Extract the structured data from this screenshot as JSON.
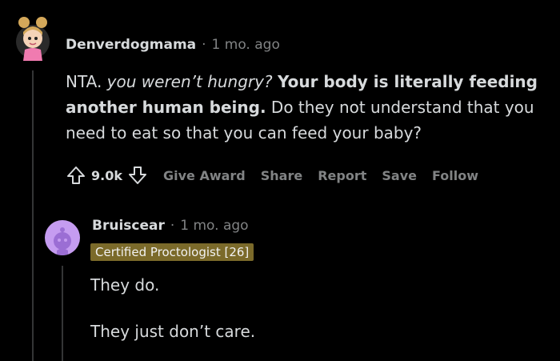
{
  "comment": {
    "username": "Denverdogmama",
    "separator": "·",
    "time": "1 mo. ago",
    "body": {
      "seg1": "NTA. ",
      "seg2_italic": "you weren’t hungry?",
      "seg3": " ",
      "seg4_bold": "Your body is literally feeding another human being.",
      "seg5": " Do they not understand that you need to eat so that you can feed your baby?"
    },
    "actions": {
      "score": "9.0k",
      "give_award": "Give Award",
      "share": "Share",
      "report": "Report",
      "save": "Save",
      "follow": "Follow"
    }
  },
  "reply": {
    "username": "Bruiscear",
    "separator": "·",
    "time": "1 mo. ago",
    "flair": "Certified Proctologist [26]",
    "paragraph1": "They do.",
    "paragraph2": "They just don’t care."
  },
  "colors": {
    "background": "#000000",
    "text": "#d7dadc",
    "muted": "#818384",
    "flair_bg": "#7b6a2a",
    "avatar2_bg": "#c59cf0"
  },
  "icons": {
    "upvote": "upvote-arrow-icon",
    "downvote": "downvote-arrow-icon",
    "avatar1": "girl-avatar-icon",
    "avatar2": "snoo-avatar-icon"
  }
}
